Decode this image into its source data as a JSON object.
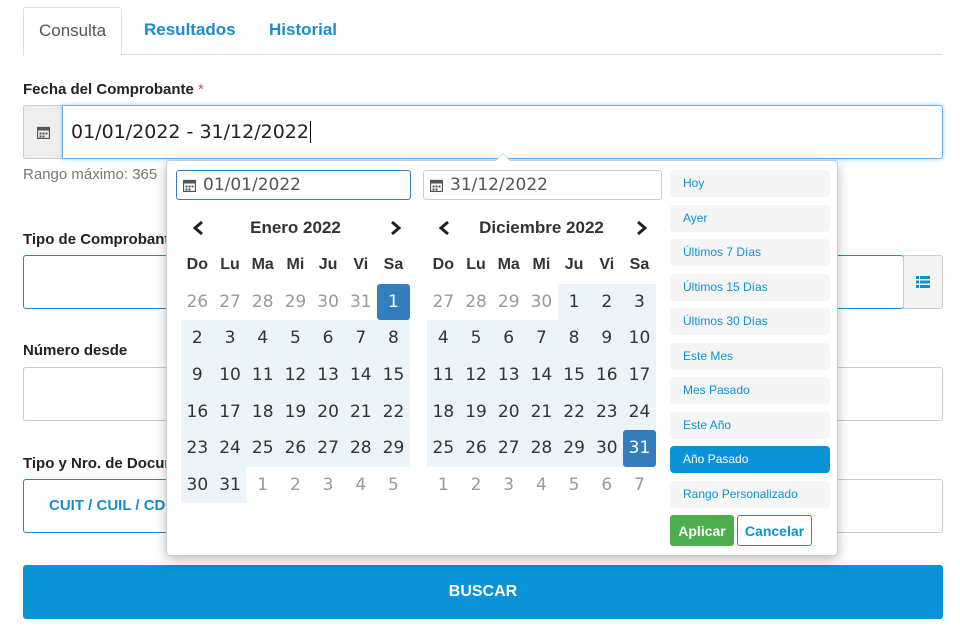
{
  "tabs": [
    "Consulta",
    "Resultados",
    "Historial"
  ],
  "fecha": {
    "label": "Fecha del Comprobante",
    "required_mark": "*",
    "value": "01/01/2022 - 31/12/2022",
    "help": "Rango máximo: 365"
  },
  "tipo_comprobante": {
    "label": "Tipo de Comprobante"
  },
  "numero_desde": {
    "label": "Número desde"
  },
  "tipo_doc": {
    "label": "Tipo y Nro. de Docum",
    "select_label": "CUIT / CUIL / CDI"
  },
  "buscar_label": "BUSCAR",
  "picker": {
    "start_input": "01/01/2022",
    "end_input": "31/12/2022",
    "weekdays": [
      "Do",
      "Lu",
      "Ma",
      "Mi",
      "Ju",
      "Vi",
      "Sa"
    ],
    "left": {
      "title": "Enero 2022",
      "days": [
        [
          "26",
          "off"
        ],
        [
          "27",
          "off"
        ],
        [
          "28",
          "off"
        ],
        [
          "29",
          "off"
        ],
        [
          "30",
          "off"
        ],
        [
          "31",
          "off"
        ],
        [
          "1",
          "sel"
        ],
        [
          "2",
          "inr"
        ],
        [
          "3",
          "inr"
        ],
        [
          "4",
          "inr"
        ],
        [
          "5",
          "inr"
        ],
        [
          "6",
          "inr"
        ],
        [
          "7",
          "inr"
        ],
        [
          "8",
          "inr"
        ],
        [
          "9",
          "inr"
        ],
        [
          "10",
          "inr"
        ],
        [
          "11",
          "inr"
        ],
        [
          "12",
          "inr"
        ],
        [
          "13",
          "inr"
        ],
        [
          "14",
          "inr"
        ],
        [
          "15",
          "inr"
        ],
        [
          "16",
          "inr"
        ],
        [
          "17",
          "inr"
        ],
        [
          "18",
          "inr"
        ],
        [
          "19",
          "inr"
        ],
        [
          "20",
          "inr"
        ],
        [
          "21",
          "inr"
        ],
        [
          "22",
          "inr"
        ],
        [
          "23",
          "inr"
        ],
        [
          "24",
          "inr"
        ],
        [
          "25",
          "inr"
        ],
        [
          "26",
          "inr"
        ],
        [
          "27",
          "inr"
        ],
        [
          "28",
          "inr"
        ],
        [
          "29",
          "inr"
        ],
        [
          "30",
          "inr"
        ],
        [
          "31",
          "inr"
        ],
        [
          "1",
          "off"
        ],
        [
          "2",
          "off"
        ],
        [
          "3",
          "off"
        ],
        [
          "4",
          "off"
        ],
        [
          "5",
          "off"
        ]
      ]
    },
    "right": {
      "title": "Diciembre 2022",
      "days": [
        [
          "27",
          "off"
        ],
        [
          "28",
          "off"
        ],
        [
          "29",
          "off"
        ],
        [
          "30",
          "off"
        ],
        [
          "1",
          "inr"
        ],
        [
          "2",
          "inr"
        ],
        [
          "3",
          "inr"
        ],
        [
          "4",
          "inr"
        ],
        [
          "5",
          "inr"
        ],
        [
          "6",
          "inr"
        ],
        [
          "7",
          "inr"
        ],
        [
          "8",
          "inr"
        ],
        [
          "9",
          "inr"
        ],
        [
          "10",
          "inr"
        ],
        [
          "11",
          "inr"
        ],
        [
          "12",
          "inr"
        ],
        [
          "13",
          "inr"
        ],
        [
          "14",
          "inr"
        ],
        [
          "15",
          "inr"
        ],
        [
          "16",
          "inr"
        ],
        [
          "17",
          "inr"
        ],
        [
          "18",
          "inr"
        ],
        [
          "19",
          "inr"
        ],
        [
          "20",
          "inr"
        ],
        [
          "21",
          "inr"
        ],
        [
          "22",
          "inr"
        ],
        [
          "23",
          "inr"
        ],
        [
          "24",
          "inr"
        ],
        [
          "25",
          "inr"
        ],
        [
          "26",
          "inr"
        ],
        [
          "27",
          "inr"
        ],
        [
          "28",
          "inr"
        ],
        [
          "29",
          "inr"
        ],
        [
          "30",
          "inr"
        ],
        [
          "31",
          "sel"
        ],
        [
          "1",
          "off"
        ],
        [
          "2",
          "off"
        ],
        [
          "3",
          "off"
        ],
        [
          "4",
          "off"
        ],
        [
          "5",
          "off"
        ],
        [
          "6",
          "off"
        ],
        [
          "7",
          "off"
        ]
      ]
    },
    "ranges": [
      "Hoy",
      "Ayer",
      "Últimos 7 Días",
      "Últimos 15 Días",
      "Últimos 30 Días",
      "Este Mes",
      "Mes Pasado",
      "Este Año",
      "Año Pasado",
      "Rango Personalizado"
    ],
    "active_range": "Año Pasado",
    "apply_label": "Aplicar",
    "cancel_label": "Cancelar"
  },
  "colors": {
    "primary": "#0a93d6",
    "selected": "#357ebd",
    "in_range": "#ebf4f8",
    "apply": "#4cae4c"
  }
}
